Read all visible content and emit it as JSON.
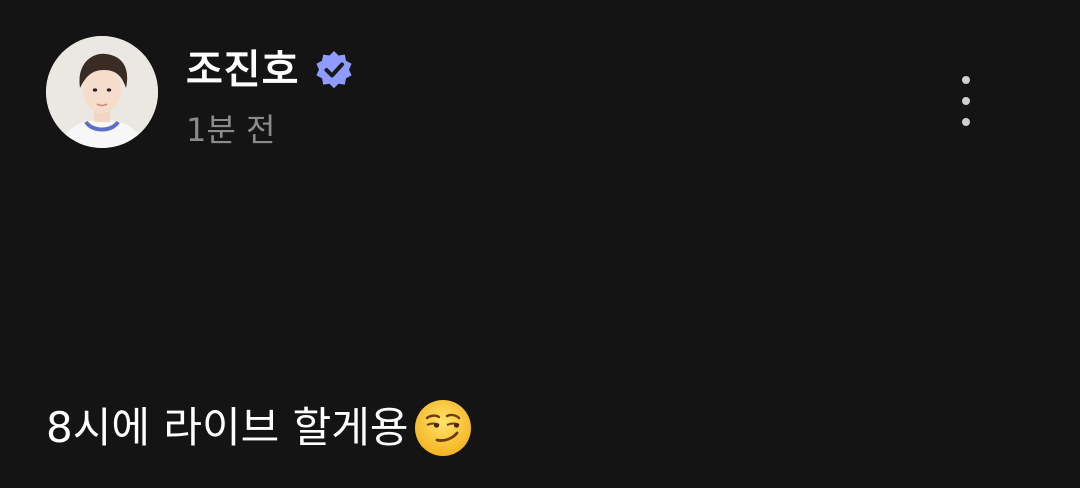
{
  "post": {
    "author": {
      "name": "조진호",
      "verified": true,
      "avatar_icon": "profile-photo",
      "verified_icon": "verified-badge-icon",
      "verified_color": "#8f9bff"
    },
    "timestamp": "1분 전",
    "menu_icon": "more-vertical-icon",
    "text": "8시에 라이브 할게용",
    "emoji_icon": "smirking-face-icon"
  },
  "colors": {
    "background": "#141414",
    "text_primary": "#ffffff",
    "text_secondary": "#8b8b8b"
  }
}
